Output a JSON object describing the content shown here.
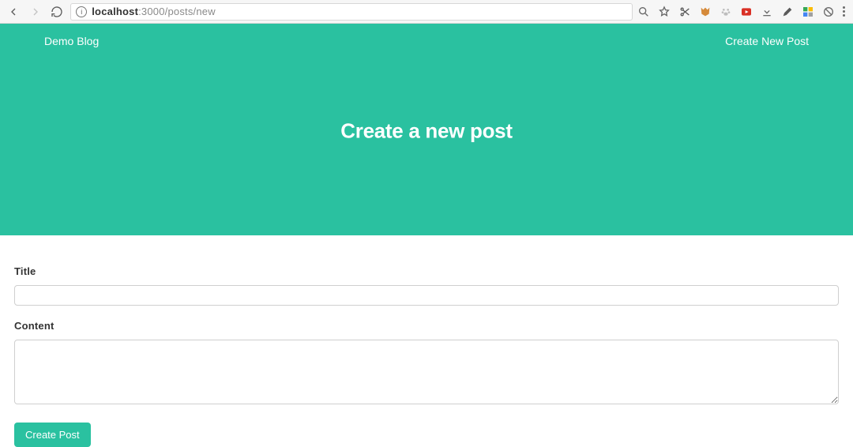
{
  "browser": {
    "url_host": "localhost",
    "url_rest": ":3000/posts/new"
  },
  "hero": {
    "brand": "Demo Blog",
    "nav_create": "Create New Post",
    "title": "Create a new post"
  },
  "form": {
    "title_label": "Title",
    "title_value": "",
    "content_label": "Content",
    "content_value": "",
    "submit_label": "Create Post"
  }
}
